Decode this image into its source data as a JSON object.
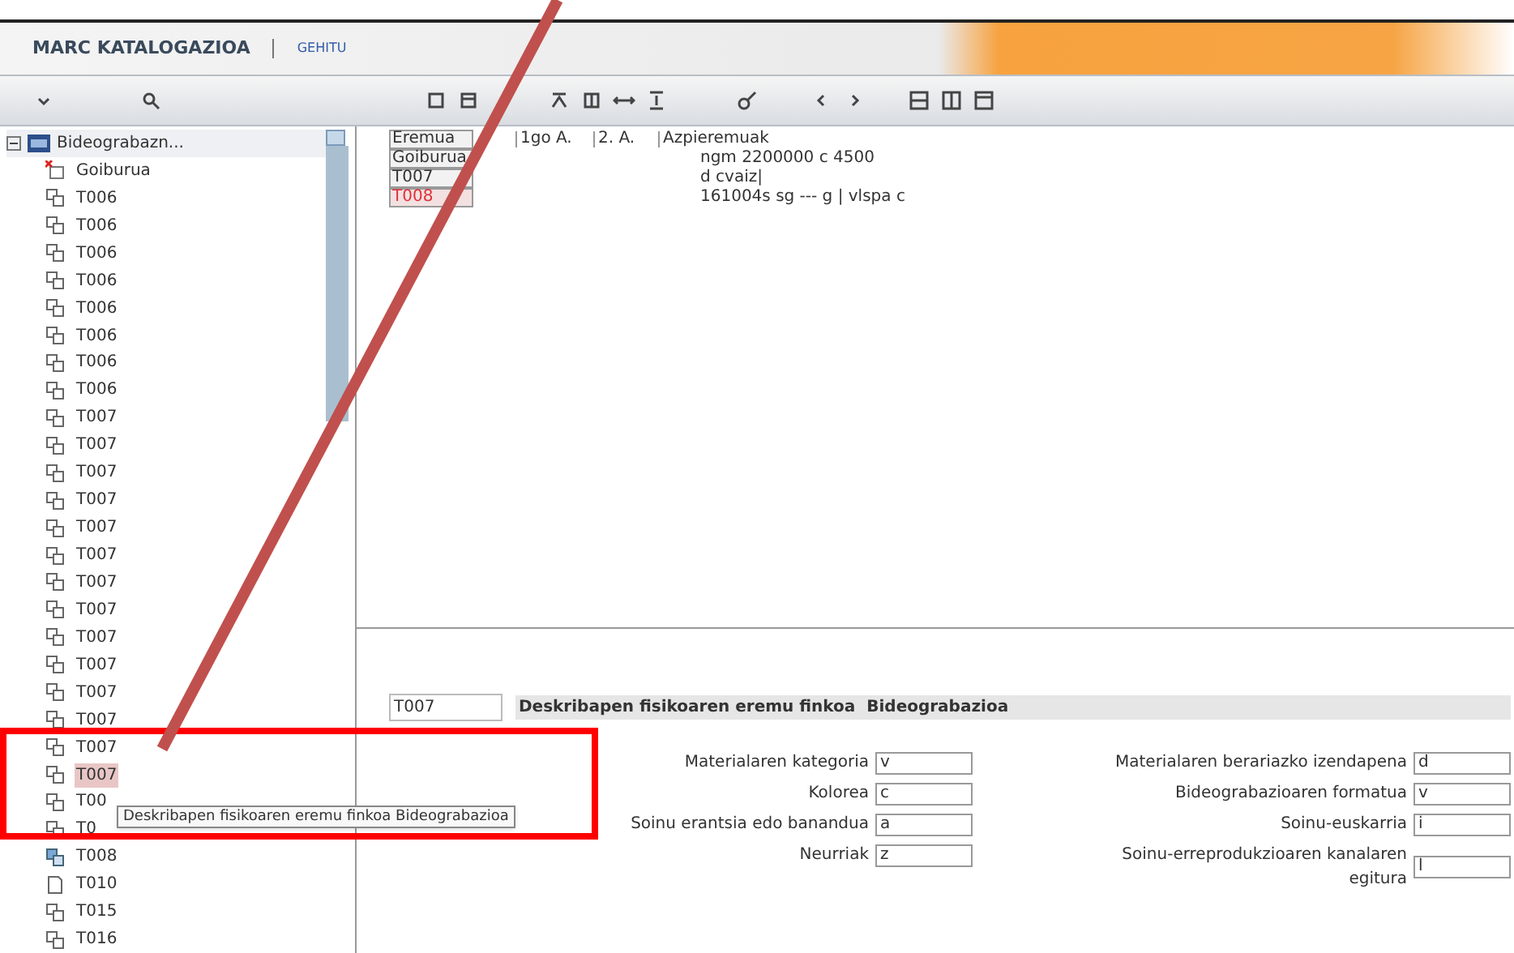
{
  "header": {
    "title": "MARC KATALOGAZIOA",
    "link": "GEHITU"
  },
  "tree": {
    "label": "Bideograbazn...",
    "expanded": true,
    "children": [
      {
        "label": "Goiburua",
        "kind": "header",
        "selected": false
      },
      {
        "label": "T006",
        "kind": "field",
        "selected": false
      },
      {
        "label": "T006",
        "kind": "field",
        "selected": false
      },
      {
        "label": "T006",
        "kind": "field",
        "selected": false
      },
      {
        "label": "T006",
        "kind": "field",
        "selected": false
      },
      {
        "label": "T006",
        "kind": "field",
        "selected": false
      },
      {
        "label": "T006",
        "kind": "field",
        "selected": false
      },
      {
        "label": "T006",
        "kind": "field",
        "selected": false
      },
      {
        "label": "T006",
        "kind": "field",
        "selected": false
      },
      {
        "label": "T007",
        "kind": "field",
        "selected": false
      },
      {
        "label": "T007",
        "kind": "field",
        "selected": false
      },
      {
        "label": "T007",
        "kind": "field",
        "selected": false
      },
      {
        "label": "T007",
        "kind": "field",
        "selected": false
      },
      {
        "label": "T007",
        "kind": "field",
        "selected": false
      },
      {
        "label": "T007",
        "kind": "field",
        "selected": false
      },
      {
        "label": "T007",
        "kind": "field",
        "selected": false
      },
      {
        "label": "T007",
        "kind": "field",
        "selected": false
      },
      {
        "label": "T007",
        "kind": "field",
        "selected": false
      },
      {
        "label": "T007",
        "kind": "field",
        "selected": false
      },
      {
        "label": "T007",
        "kind": "field",
        "selected": false
      },
      {
        "label": "T007",
        "kind": "field",
        "selected": false
      },
      {
        "label": "T007",
        "kind": "field",
        "selected": false
      },
      {
        "label": "T007",
        "kind": "field",
        "selected": true
      },
      {
        "label": "T00",
        "kind": "field",
        "selected": false
      },
      {
        "label": "T0",
        "kind": "field",
        "selected": false
      },
      {
        "label": "T008",
        "kind": "fixed",
        "selected": false
      },
      {
        "label": "T010",
        "kind": "page",
        "selected": false
      },
      {
        "label": "T015",
        "kind": "field",
        "selected": false
      },
      {
        "label": "T016",
        "kind": "field",
        "selected": false
      }
    ]
  },
  "tooltip": "Deskribapen fisikoaren eremu finkoa Bideograbazioa",
  "table": {
    "columns": [
      "Eremua",
      "1go A.",
      "2. A.",
      "Azpieremuak"
    ],
    "rows": [
      {
        "field": "Goiburua",
        "value": "ngm 2200000 c 4500",
        "highlighted": false
      },
      {
        "field": "T007",
        "value": "d cvaiz|",
        "highlighted": false
      },
      {
        "field": "T008",
        "value": "161004s sg --- g | vlspa c",
        "highlighted": true
      }
    ]
  },
  "form": {
    "code": "T007",
    "title": "Deskribapen fisikoaren eremu finkoa  Bideograbazioa",
    "left": [
      {
        "label": "Materialaren kategoria",
        "value": "v"
      },
      {
        "label": "Kolorea",
        "value": "c"
      },
      {
        "label": "Soinu erantsia edo banandua",
        "value": "a"
      },
      {
        "label": "Neurriak",
        "value": "z"
      }
    ],
    "right": [
      {
        "label": "Materialaren berariazko izendapena",
        "value": "d"
      },
      {
        "label": "Bideograbazioaren formatua",
        "value": "v"
      },
      {
        "label": "Soinu-euskarria",
        "value": "i"
      },
      {
        "label": "Soinu-erreprodukzioaren kanalaren egitura",
        "value": "l"
      }
    ]
  }
}
